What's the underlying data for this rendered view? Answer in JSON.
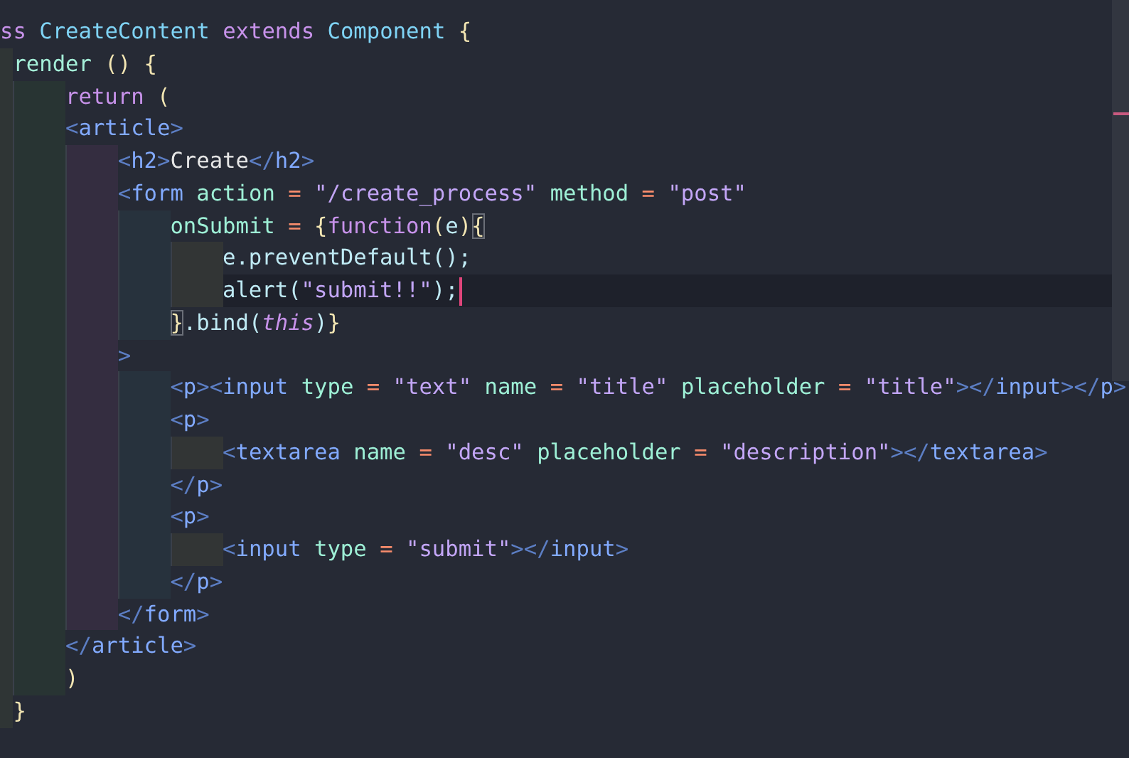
{
  "editor": {
    "lines": [
      {
        "current": false,
        "tokens": [
          {
            "kind": "keyword",
            "text": "ss "
          },
          {
            "kind": "class",
            "text": "CreateContent "
          },
          {
            "kind": "keyword",
            "text": "extends "
          },
          {
            "kind": "class",
            "text": "Component "
          },
          {
            "kind": "brace",
            "text": "{"
          }
        ]
      },
      {
        "current": false,
        "indent_bands": [
          {
            "kind": "edge"
          }
        ],
        "tokens": [
          {
            "kind": "method",
            "text": "render "
          },
          {
            "kind": "brace",
            "text": "() {"
          }
        ]
      },
      {
        "current": false,
        "indent_bands": [
          {
            "kind": "edge"
          },
          {
            "kind": "full"
          }
        ],
        "tokens": [
          {
            "kind": "keyword",
            "text": "return "
          },
          {
            "kind": "brace",
            "text": "("
          }
        ]
      },
      {
        "current": false,
        "indent_bands": [
          {
            "kind": "edge"
          },
          {
            "kind": "full"
          }
        ],
        "tokens": [
          {
            "kind": "punct",
            "text": "<"
          },
          {
            "kind": "tag",
            "text": "article"
          },
          {
            "kind": "punct",
            "text": ">"
          }
        ]
      },
      {
        "current": false,
        "indent_bands": [
          {
            "kind": "edge"
          },
          {
            "kind": "full"
          },
          {
            "kind": "full"
          }
        ],
        "tokens": [
          {
            "kind": "punct",
            "text": "<"
          },
          {
            "kind": "tag",
            "text": "h2"
          },
          {
            "kind": "punct",
            "text": ">"
          },
          {
            "kind": "text",
            "text": "Create"
          },
          {
            "kind": "punct",
            "text": "</"
          },
          {
            "kind": "tag",
            "text": "h2"
          },
          {
            "kind": "punct",
            "text": ">"
          }
        ]
      },
      {
        "current": false,
        "indent_bands": [
          {
            "kind": "edge"
          },
          {
            "kind": "full"
          },
          {
            "kind": "full"
          }
        ],
        "tokens": [
          {
            "kind": "punct",
            "text": "<"
          },
          {
            "kind": "tag",
            "text": "form "
          },
          {
            "kind": "attr",
            "text": "action "
          },
          {
            "kind": "op",
            "text": "= "
          },
          {
            "kind": "string",
            "text": "\"/create_process\" "
          },
          {
            "kind": "attr",
            "text": "method "
          },
          {
            "kind": "op",
            "text": "= "
          },
          {
            "kind": "string",
            "text": "\"post\""
          }
        ]
      },
      {
        "current": false,
        "indent_bands": [
          {
            "kind": "edge"
          },
          {
            "kind": "full"
          },
          {
            "kind": "full"
          },
          {
            "kind": "full"
          }
        ],
        "tokens": [
          {
            "kind": "attr",
            "text": "onSubmit "
          },
          {
            "kind": "op",
            "text": "= "
          },
          {
            "kind": "brace",
            "text": "{"
          },
          {
            "kind": "keyword",
            "text": "function"
          },
          {
            "kind": "brace",
            "text": "("
          },
          {
            "kind": "ident",
            "text": "e"
          },
          {
            "kind": "brace",
            "text": ")"
          },
          {
            "kind": "match",
            "text": "{"
          }
        ]
      },
      {
        "current": false,
        "indent_bands": [
          {
            "kind": "edge"
          },
          {
            "kind": "full"
          },
          {
            "kind": "full"
          },
          {
            "kind": "full"
          },
          {
            "kind": "full"
          }
        ],
        "tokens": [
          {
            "kind": "ident",
            "text": "e.preventDefault();"
          }
        ]
      },
      {
        "current": true,
        "indent_bands": [
          {
            "kind": "edge"
          },
          {
            "kind": "full"
          },
          {
            "kind": "full"
          },
          {
            "kind": "full"
          },
          {
            "kind": "full"
          }
        ],
        "tokens": [
          {
            "kind": "ident",
            "text": "alert("
          },
          {
            "kind": "string",
            "text": "\"submit!!\""
          },
          {
            "kind": "ident",
            "text": ");"
          }
        ]
      },
      {
        "current": false,
        "indent_bands": [
          {
            "kind": "edge"
          },
          {
            "kind": "full"
          },
          {
            "kind": "full"
          },
          {
            "kind": "full"
          }
        ],
        "tokens": [
          {
            "kind": "match",
            "text": "}"
          },
          {
            "kind": "ident",
            "text": ".bind("
          },
          {
            "kind": "this",
            "text": "this"
          },
          {
            "kind": "ident",
            "text": ")"
          },
          {
            "kind": "brace",
            "text": "}"
          }
        ]
      },
      {
        "current": false,
        "indent_bands": [
          {
            "kind": "edge"
          },
          {
            "kind": "full"
          },
          {
            "kind": "full"
          }
        ],
        "tokens": [
          {
            "kind": "punct",
            "text": ">"
          }
        ]
      },
      {
        "current": false,
        "indent_bands": [
          {
            "kind": "edge"
          },
          {
            "kind": "full"
          },
          {
            "kind": "full"
          },
          {
            "kind": "full"
          }
        ],
        "tokens": [
          {
            "kind": "punct",
            "text": "<"
          },
          {
            "kind": "tag",
            "text": "p"
          },
          {
            "kind": "punct",
            "text": "><"
          },
          {
            "kind": "tag",
            "text": "input "
          },
          {
            "kind": "attr",
            "text": "type "
          },
          {
            "kind": "op",
            "text": "= "
          },
          {
            "kind": "string",
            "text": "\"text\" "
          },
          {
            "kind": "attr",
            "text": "name "
          },
          {
            "kind": "op",
            "text": "= "
          },
          {
            "kind": "string",
            "text": "\"title\" "
          },
          {
            "kind": "attr",
            "text": "placeholder "
          },
          {
            "kind": "op",
            "text": "= "
          },
          {
            "kind": "string",
            "text": "\"title\""
          },
          {
            "kind": "punct",
            "text": "></"
          },
          {
            "kind": "tag",
            "text": "input"
          },
          {
            "kind": "punct",
            "text": "></"
          },
          {
            "kind": "tag",
            "text": "p"
          },
          {
            "kind": "punct",
            "text": ">"
          }
        ]
      },
      {
        "current": false,
        "indent_bands": [
          {
            "kind": "edge"
          },
          {
            "kind": "full"
          },
          {
            "kind": "full"
          },
          {
            "kind": "full"
          }
        ],
        "tokens": [
          {
            "kind": "punct",
            "text": "<"
          },
          {
            "kind": "tag",
            "text": "p"
          },
          {
            "kind": "punct",
            "text": ">"
          }
        ]
      },
      {
        "current": false,
        "indent_bands": [
          {
            "kind": "edge"
          },
          {
            "kind": "full"
          },
          {
            "kind": "full"
          },
          {
            "kind": "full"
          },
          {
            "kind": "full"
          }
        ],
        "tokens": [
          {
            "kind": "punct",
            "text": "<"
          },
          {
            "kind": "tag",
            "text": "textarea "
          },
          {
            "kind": "attr",
            "text": "name "
          },
          {
            "kind": "op",
            "text": "= "
          },
          {
            "kind": "string",
            "text": "\"desc\" "
          },
          {
            "kind": "attr",
            "text": "placeholder "
          },
          {
            "kind": "op",
            "text": "= "
          },
          {
            "kind": "string",
            "text": "\"description\""
          },
          {
            "kind": "punct",
            "text": "></"
          },
          {
            "kind": "tag",
            "text": "textarea"
          },
          {
            "kind": "punct",
            "text": ">"
          }
        ]
      },
      {
        "current": false,
        "indent_bands": [
          {
            "kind": "edge"
          },
          {
            "kind": "full"
          },
          {
            "kind": "full"
          },
          {
            "kind": "full"
          }
        ],
        "tokens": [
          {
            "kind": "punct",
            "text": "</"
          },
          {
            "kind": "tag",
            "text": "p"
          },
          {
            "kind": "punct",
            "text": ">"
          }
        ]
      },
      {
        "current": false,
        "indent_bands": [
          {
            "kind": "edge"
          },
          {
            "kind": "full"
          },
          {
            "kind": "full"
          },
          {
            "kind": "full"
          }
        ],
        "tokens": [
          {
            "kind": "punct",
            "text": "<"
          },
          {
            "kind": "tag",
            "text": "p"
          },
          {
            "kind": "punct",
            "text": ">"
          }
        ]
      },
      {
        "current": false,
        "indent_bands": [
          {
            "kind": "edge"
          },
          {
            "kind": "full"
          },
          {
            "kind": "full"
          },
          {
            "kind": "full"
          },
          {
            "kind": "full"
          }
        ],
        "tokens": [
          {
            "kind": "punct",
            "text": "<"
          },
          {
            "kind": "tag",
            "text": "input "
          },
          {
            "kind": "attr",
            "text": "type "
          },
          {
            "kind": "op",
            "text": "= "
          },
          {
            "kind": "string",
            "text": "\"submit\""
          },
          {
            "kind": "punct",
            "text": "></"
          },
          {
            "kind": "tag",
            "text": "input"
          },
          {
            "kind": "punct",
            "text": ">"
          }
        ]
      },
      {
        "current": false,
        "indent_bands": [
          {
            "kind": "edge"
          },
          {
            "kind": "full"
          },
          {
            "kind": "full"
          },
          {
            "kind": "full"
          }
        ],
        "tokens": [
          {
            "kind": "punct",
            "text": "</"
          },
          {
            "kind": "tag",
            "text": "p"
          },
          {
            "kind": "punct",
            "text": ">"
          }
        ]
      },
      {
        "current": false,
        "indent_bands": [
          {
            "kind": "edge"
          },
          {
            "kind": "full"
          },
          {
            "kind": "full"
          }
        ],
        "tokens": [
          {
            "kind": "punct",
            "text": "</"
          },
          {
            "kind": "tag",
            "text": "form"
          },
          {
            "kind": "punct",
            "text": ">"
          }
        ]
      },
      {
        "current": false,
        "indent_bands": [
          {
            "kind": "edge"
          },
          {
            "kind": "full"
          }
        ],
        "tokens": [
          {
            "kind": "punct",
            "text": "</"
          },
          {
            "kind": "tag",
            "text": "article"
          },
          {
            "kind": "punct",
            "text": ">"
          }
        ]
      },
      {
        "current": false,
        "indent_bands": [
          {
            "kind": "edge"
          },
          {
            "kind": "full"
          }
        ],
        "tokens": [
          {
            "kind": "brace",
            "text": ")"
          }
        ]
      },
      {
        "current": false,
        "indent_bands": [
          {
            "kind": "edge"
          }
        ],
        "tokens": [
          {
            "kind": "brace",
            "text": "}"
          }
        ]
      }
    ]
  }
}
